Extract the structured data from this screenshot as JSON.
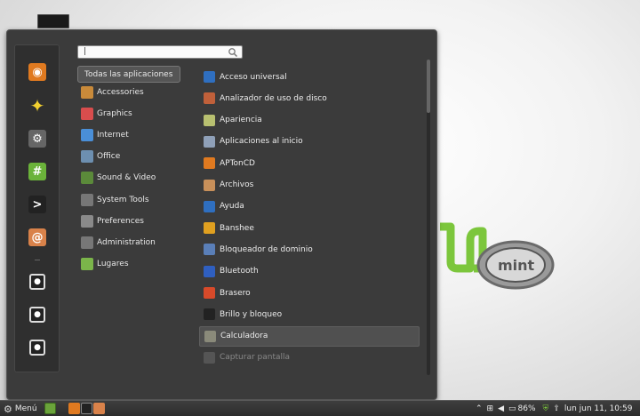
{
  "search": {
    "placeholder": "",
    "value": "|"
  },
  "categories": [
    {
      "label": "Todas las aplicaciones",
      "icon": "all-apps",
      "selected": true
    },
    {
      "label": "Accessories",
      "icon": "accessories-icon",
      "color": "#c98a3a"
    },
    {
      "label": "Graphics",
      "icon": "graphics-icon",
      "color": "#d84d4d"
    },
    {
      "label": "Internet",
      "icon": "internet-icon",
      "color": "#4a8fd8"
    },
    {
      "label": "Office",
      "icon": "office-icon",
      "color": "#6d8fb0"
    },
    {
      "label": "Sound & Video",
      "icon": "sound-video-icon",
      "color": "#5b8a3a"
    },
    {
      "label": "System Tools",
      "icon": "system-tools-icon",
      "color": "#777777"
    },
    {
      "label": "Preferences",
      "icon": "preferences-icon",
      "color": "#8a8a8a"
    },
    {
      "label": "Administration",
      "icon": "administration-icon",
      "color": "#777777"
    },
    {
      "label": "Lugares",
      "icon": "folder-icon",
      "color": "#7bb54a"
    }
  ],
  "applications": [
    {
      "label": "Acceso universal",
      "icon": "accessibility-icon",
      "color": "#2f6fc0"
    },
    {
      "label": "Analizador de uso de disco",
      "icon": "disk-usage-icon",
      "color": "#c0603a"
    },
    {
      "label": "Apariencia",
      "icon": "appearance-icon",
      "color": "#b8c070"
    },
    {
      "label": "Aplicaciones al inicio",
      "icon": "startup-apps-icon",
      "color": "#8fa0b8"
    },
    {
      "label": "APTonCD",
      "icon": "aptoncd-icon",
      "color": "#e07a20"
    },
    {
      "label": "Archivos",
      "icon": "archive-icon",
      "color": "#c8905a"
    },
    {
      "label": "Ayuda",
      "icon": "help-icon",
      "color": "#2f6fc0"
    },
    {
      "label": "Banshee",
      "icon": "banshee-icon",
      "color": "#e0a020"
    },
    {
      "label": "Bloqueador de dominio",
      "icon": "domain-blocker-icon",
      "color": "#5a7fb8"
    },
    {
      "label": "Bluetooth",
      "icon": "bluetooth-icon",
      "color": "#2f5fc0"
    },
    {
      "label": "Brasero",
      "icon": "brasero-icon",
      "color": "#d84a2a"
    },
    {
      "label": "Brillo y bloqueo",
      "icon": "brightness-lock-icon",
      "color": "#222222"
    },
    {
      "label": "Calculadora",
      "icon": "calculator-icon",
      "color": "#8a8a7a",
      "hover": true
    },
    {
      "label": "Capturar pantalla",
      "icon": "screenshot-icon",
      "color": "#555555",
      "dim": true
    }
  ],
  "favorites": [
    {
      "name": "eye-app-icon",
      "bg": "#e07a20",
      "glyph": "◉"
    },
    {
      "name": "star-app-icon",
      "bg": "transparent",
      "glyph": "✦"
    },
    {
      "name": "synaptic-icon",
      "bg": "#666666",
      "glyph": "⚙"
    },
    {
      "name": "terminal-hash-icon",
      "bg": "#6bb33a",
      "glyph": "#"
    },
    {
      "name": "terminal-icon",
      "bg": "#222222",
      "glyph": ">"
    },
    {
      "name": "software-center-icon",
      "bg": "#d9824a",
      "glyph": "@"
    },
    {
      "name": "lock-screen-icon",
      "bg": "#222222",
      "glyph": "●"
    },
    {
      "name": "logout-icon",
      "bg": "#222222",
      "glyph": "●"
    },
    {
      "name": "shutdown-icon",
      "bg": "#222222",
      "glyph": "●"
    }
  ],
  "panel": {
    "menu_label": "Menú",
    "battery": "86%",
    "clock": "lun jun 11, 10:59"
  }
}
